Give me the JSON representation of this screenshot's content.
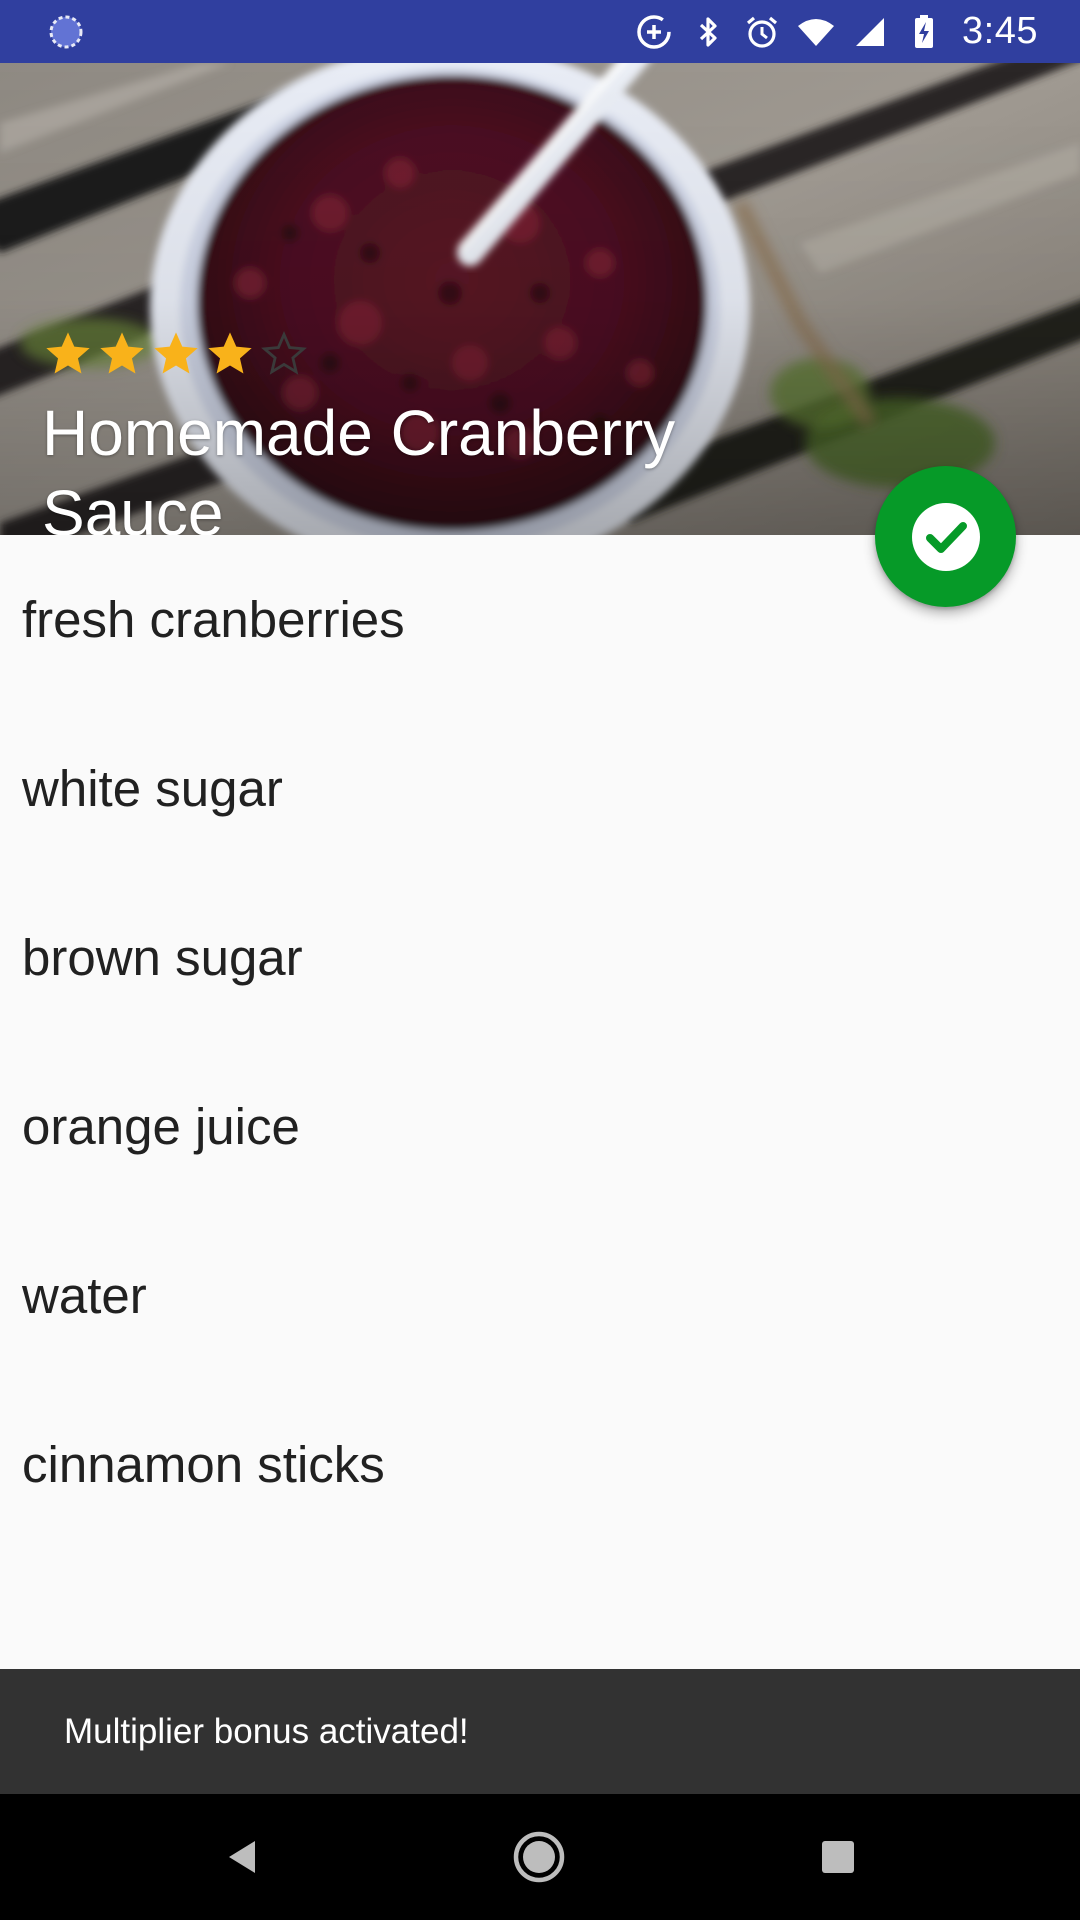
{
  "status_bar": {
    "time": "3:45",
    "background_color": "#303f9f",
    "icons": [
      "loading-icon",
      "data-saver-icon",
      "bluetooth-icon",
      "alarm-icon",
      "wifi-icon",
      "cellular-signal-icon",
      "battery-charging-icon"
    ]
  },
  "recipe": {
    "title": "Homemade Cranberry Sauce",
    "rating": 4,
    "rating_max": 5,
    "header_image": "cranberry-sauce-bowl-photo"
  },
  "ingredients": [
    "fresh cranberries",
    "white sugar",
    "brown sugar",
    "orange juice",
    "water",
    "cinnamon sticks"
  ],
  "fab": {
    "icon": "check-circle-icon",
    "color": "#069a28"
  },
  "snackbar": {
    "message": "Multiplier bonus activated!"
  },
  "nav_bar": {
    "buttons": [
      "back-icon",
      "home-icon",
      "recents-icon"
    ]
  },
  "colors": {
    "star_filled": "#f9b21a",
    "text_primary": "#212121",
    "background": "#fafafa"
  }
}
